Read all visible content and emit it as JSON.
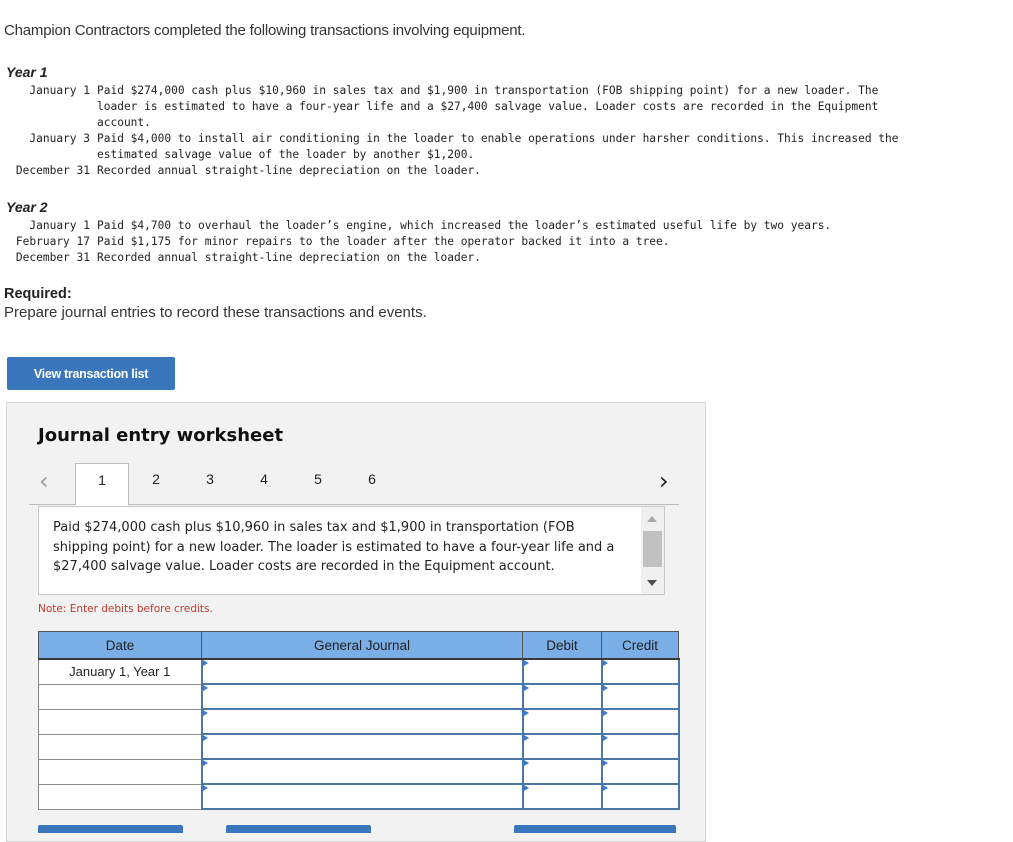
{
  "intro": "Champion Contractors completed the following transactions involving equipment.",
  "years": [
    {
      "label": "Year 1",
      "transactions": [
        {
          "date": "January 1",
          "lines": [
            "Paid $274,000 cash plus $10,960 in sales tax and $1,900 in transportation (FOB shipping point) for a new loader. The",
            "loader is estimated to have a four-year life and a $27,400 salvage value. Loader costs are recorded in the Equipment",
            "account."
          ]
        },
        {
          "date": "January 3",
          "lines": [
            "Paid $4,000 to install air conditioning in the loader to enable operations under harsher conditions. This increased the",
            "estimated salvage value of the loader by another $1,200."
          ]
        },
        {
          "date": "December 31",
          "lines": [
            "Recorded annual straight-line depreciation on the loader."
          ]
        }
      ]
    },
    {
      "label": "Year 2",
      "transactions": [
        {
          "date": "January 1",
          "lines": [
            "Paid $4,700 to overhaul the loader’s engine, which increased the loader’s estimated useful life by two years."
          ]
        },
        {
          "date": "February 17",
          "lines": [
            "Paid $1,175 for minor repairs to the loader after the operator backed it into a tree."
          ]
        },
        {
          "date": "December 31",
          "lines": [
            "Recorded annual straight-line depreciation on the loader."
          ]
        }
      ]
    }
  ],
  "required": {
    "label": "Required:",
    "text": "Prepare journal entries to record these transactions and events."
  },
  "view_transaction_button": "View transaction list",
  "worksheet": {
    "title": "Journal entry worksheet",
    "tabs": [
      "1",
      "2",
      "3",
      "4",
      "5",
      "6"
    ],
    "active_tab": "1",
    "prev_icon": "‹",
    "next_icon": "›",
    "description": "Paid $274,000 cash plus $10,960 in sales tax and $1,900 in transportation (FOB shipping point) for a new loader. The loader is estimated to have a four-year life and a $27,400 salvage value. Loader costs are recorded in the Equipment account.",
    "note": "Note: Enter debits before credits.",
    "table": {
      "headers": [
        "Date",
        "General Journal",
        "Debit",
        "Credit"
      ],
      "rows": [
        {
          "date": "January 1, Year 1",
          "account": "",
          "debit": "",
          "credit": ""
        },
        {
          "date": "",
          "account": "",
          "debit": "",
          "credit": ""
        },
        {
          "date": "",
          "account": "",
          "debit": "",
          "credit": ""
        },
        {
          "date": "",
          "account": "",
          "debit": "",
          "credit": ""
        },
        {
          "date": "",
          "account": "",
          "debit": "",
          "credit": ""
        },
        {
          "date": "",
          "account": "",
          "debit": "",
          "credit": ""
        }
      ]
    }
  },
  "colors": {
    "button_blue": "#3a76bb",
    "header_blue": "#7aaee6",
    "note_red": "#c0392b",
    "panel_gray": "#f2f2f2"
  }
}
